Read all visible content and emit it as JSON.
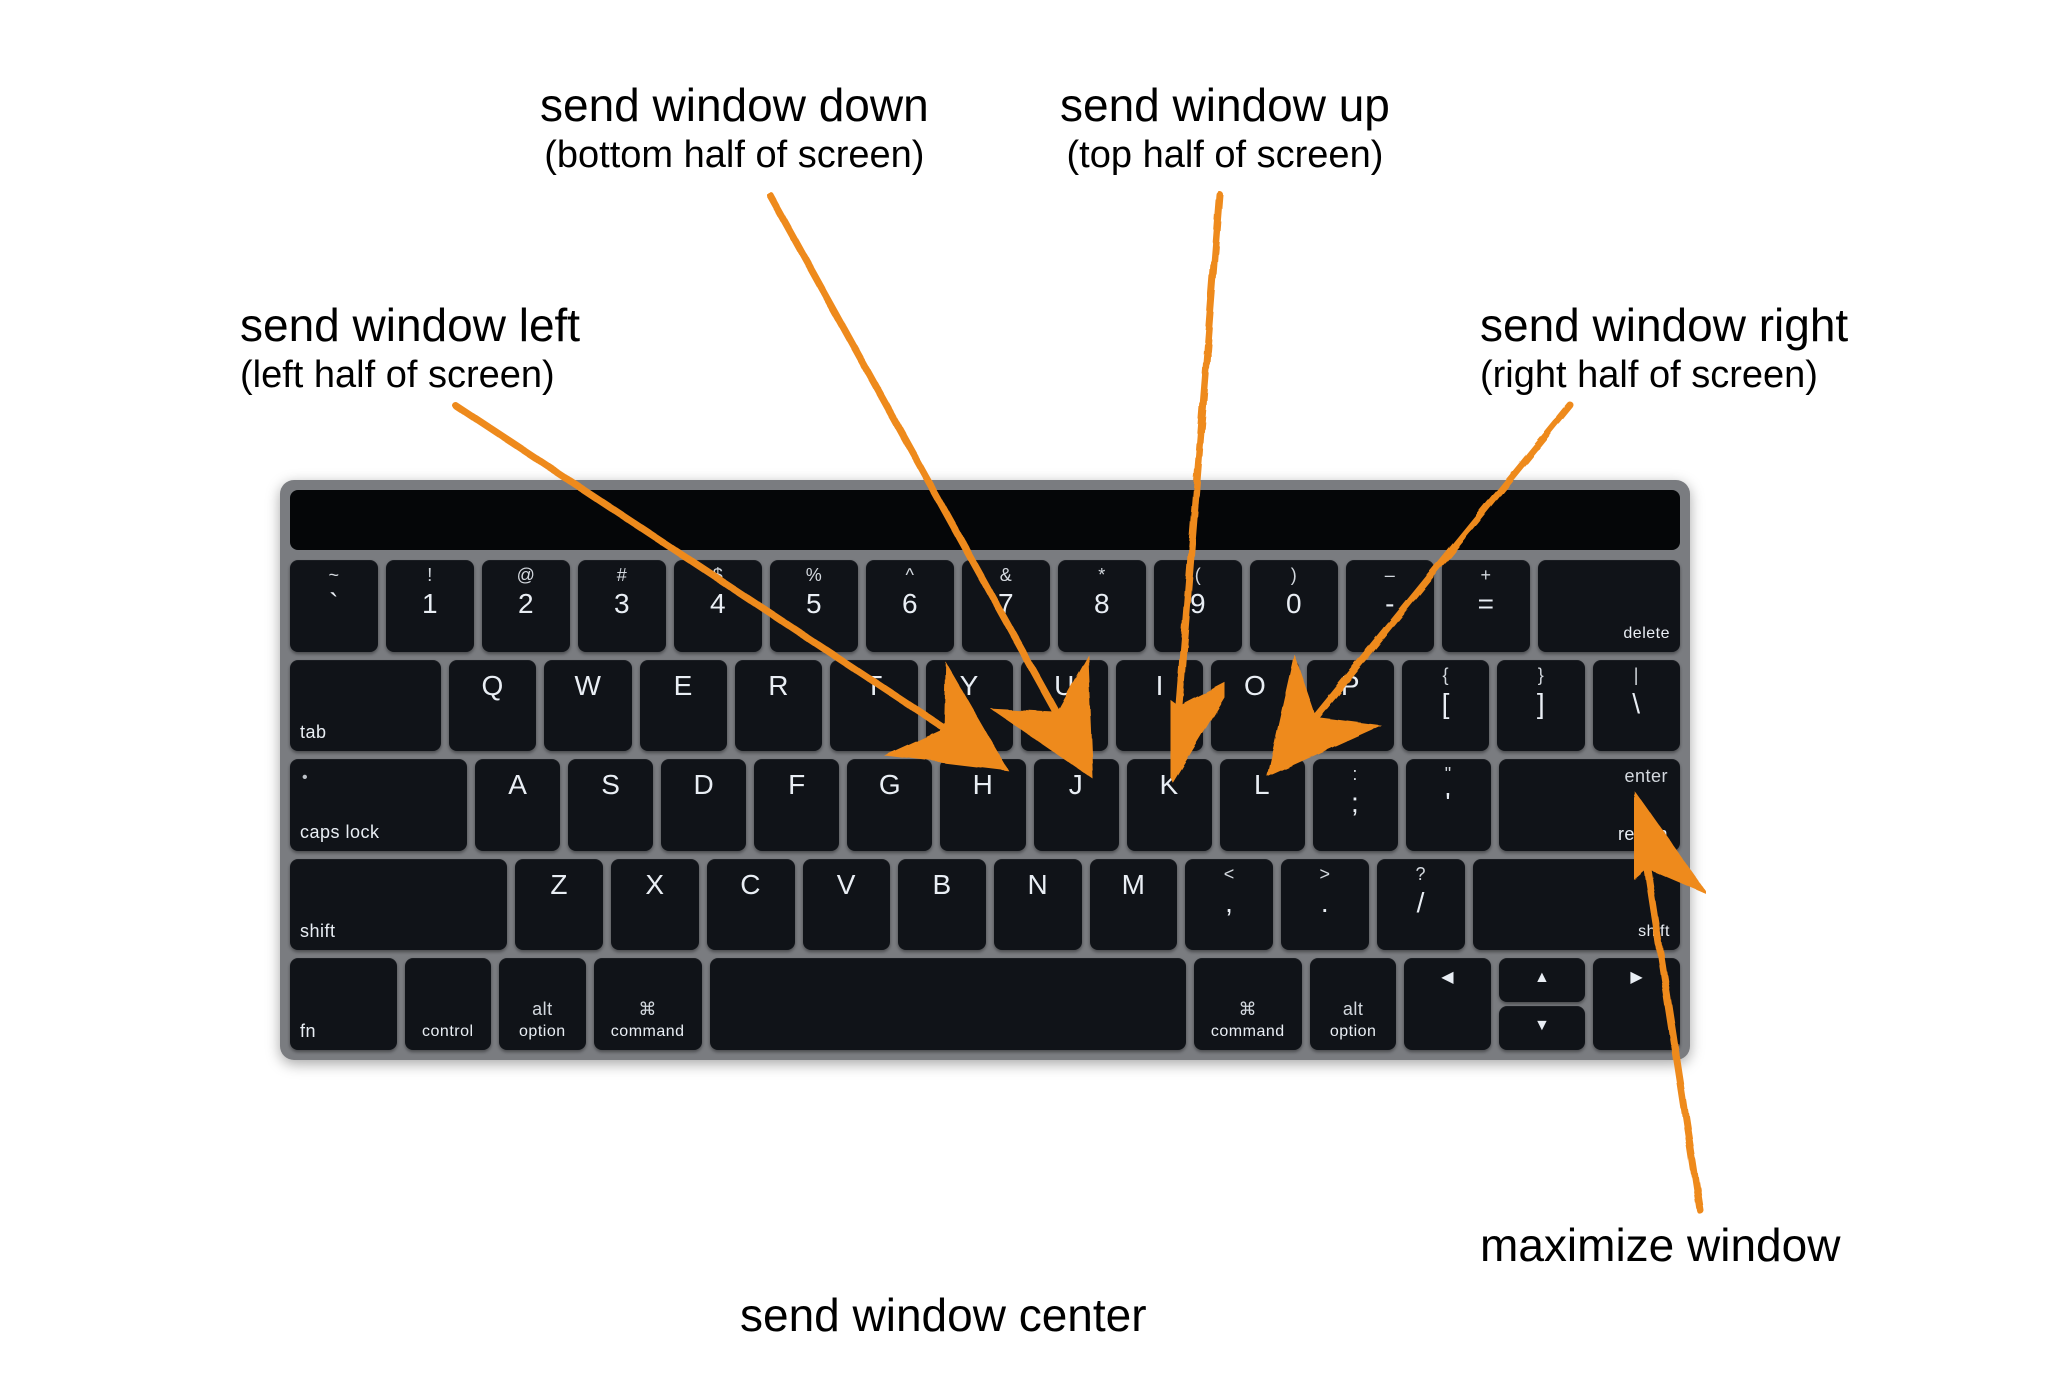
{
  "annotations": {
    "left": {
      "title": "send window left",
      "sub": "(left half of screen)"
    },
    "down": {
      "title": "send window down",
      "sub": "(bottom half of screen)"
    },
    "up": {
      "title": "send window up",
      "sub": "(top half of screen)"
    },
    "right": {
      "title": "send window right",
      "sub": "(right half of screen)"
    },
    "center": {
      "title": "send window center",
      "sub": ""
    },
    "max": {
      "title": "maximize window",
      "sub": ""
    }
  },
  "arrow_color": "#ee8a1f",
  "keyboard": {
    "row1": [
      {
        "top": "~",
        "main": "`"
      },
      {
        "top": "!",
        "main": "1"
      },
      {
        "top": "@",
        "main": "2"
      },
      {
        "top": "#",
        "main": "3"
      },
      {
        "top": "$",
        "main": "4"
      },
      {
        "top": "%",
        "main": "5"
      },
      {
        "top": "^",
        "main": "6"
      },
      {
        "top": "&",
        "main": "7"
      },
      {
        "top": "*",
        "main": "8"
      },
      {
        "top": "(",
        "main": "9"
      },
      {
        "top": ")",
        "main": "0"
      },
      {
        "top": "–",
        "main": "-"
      },
      {
        "top": "+",
        "main": "="
      }
    ],
    "delete": "delete",
    "tab": "tab",
    "row2": [
      "Q",
      "W",
      "E",
      "R",
      "T",
      "Y",
      "U",
      "I",
      "O",
      "P"
    ],
    "row2_end": [
      {
        "top": "{",
        "main": "["
      },
      {
        "top": "}",
        "main": "]"
      },
      {
        "top": "|",
        "main": "\\"
      }
    ],
    "caps": "caps lock",
    "row3": [
      "A",
      "S",
      "D",
      "F",
      "G",
      "H",
      "J",
      "K",
      "L"
    ],
    "row3_end": [
      {
        "top": ":",
        "main": ";"
      },
      {
        "top": "\"",
        "main": "'"
      }
    ],
    "enter_top": "enter",
    "enter_main": "return",
    "shift": "shift",
    "row4": [
      "Z",
      "X",
      "C",
      "V",
      "B",
      "N",
      "M"
    ],
    "row4_end": [
      {
        "top": "<",
        "main": ","
      },
      {
        "top": ">",
        "main": "."
      },
      {
        "top": "?",
        "main": "/"
      }
    ],
    "row5": {
      "fn": "fn",
      "control": "control",
      "option": "option",
      "option_sym": "alt",
      "command": "command",
      "command_sym": "⌘",
      "arrows": {
        "left": "◀",
        "up": "▲",
        "down": "▼",
        "right": "▶"
      }
    }
  }
}
